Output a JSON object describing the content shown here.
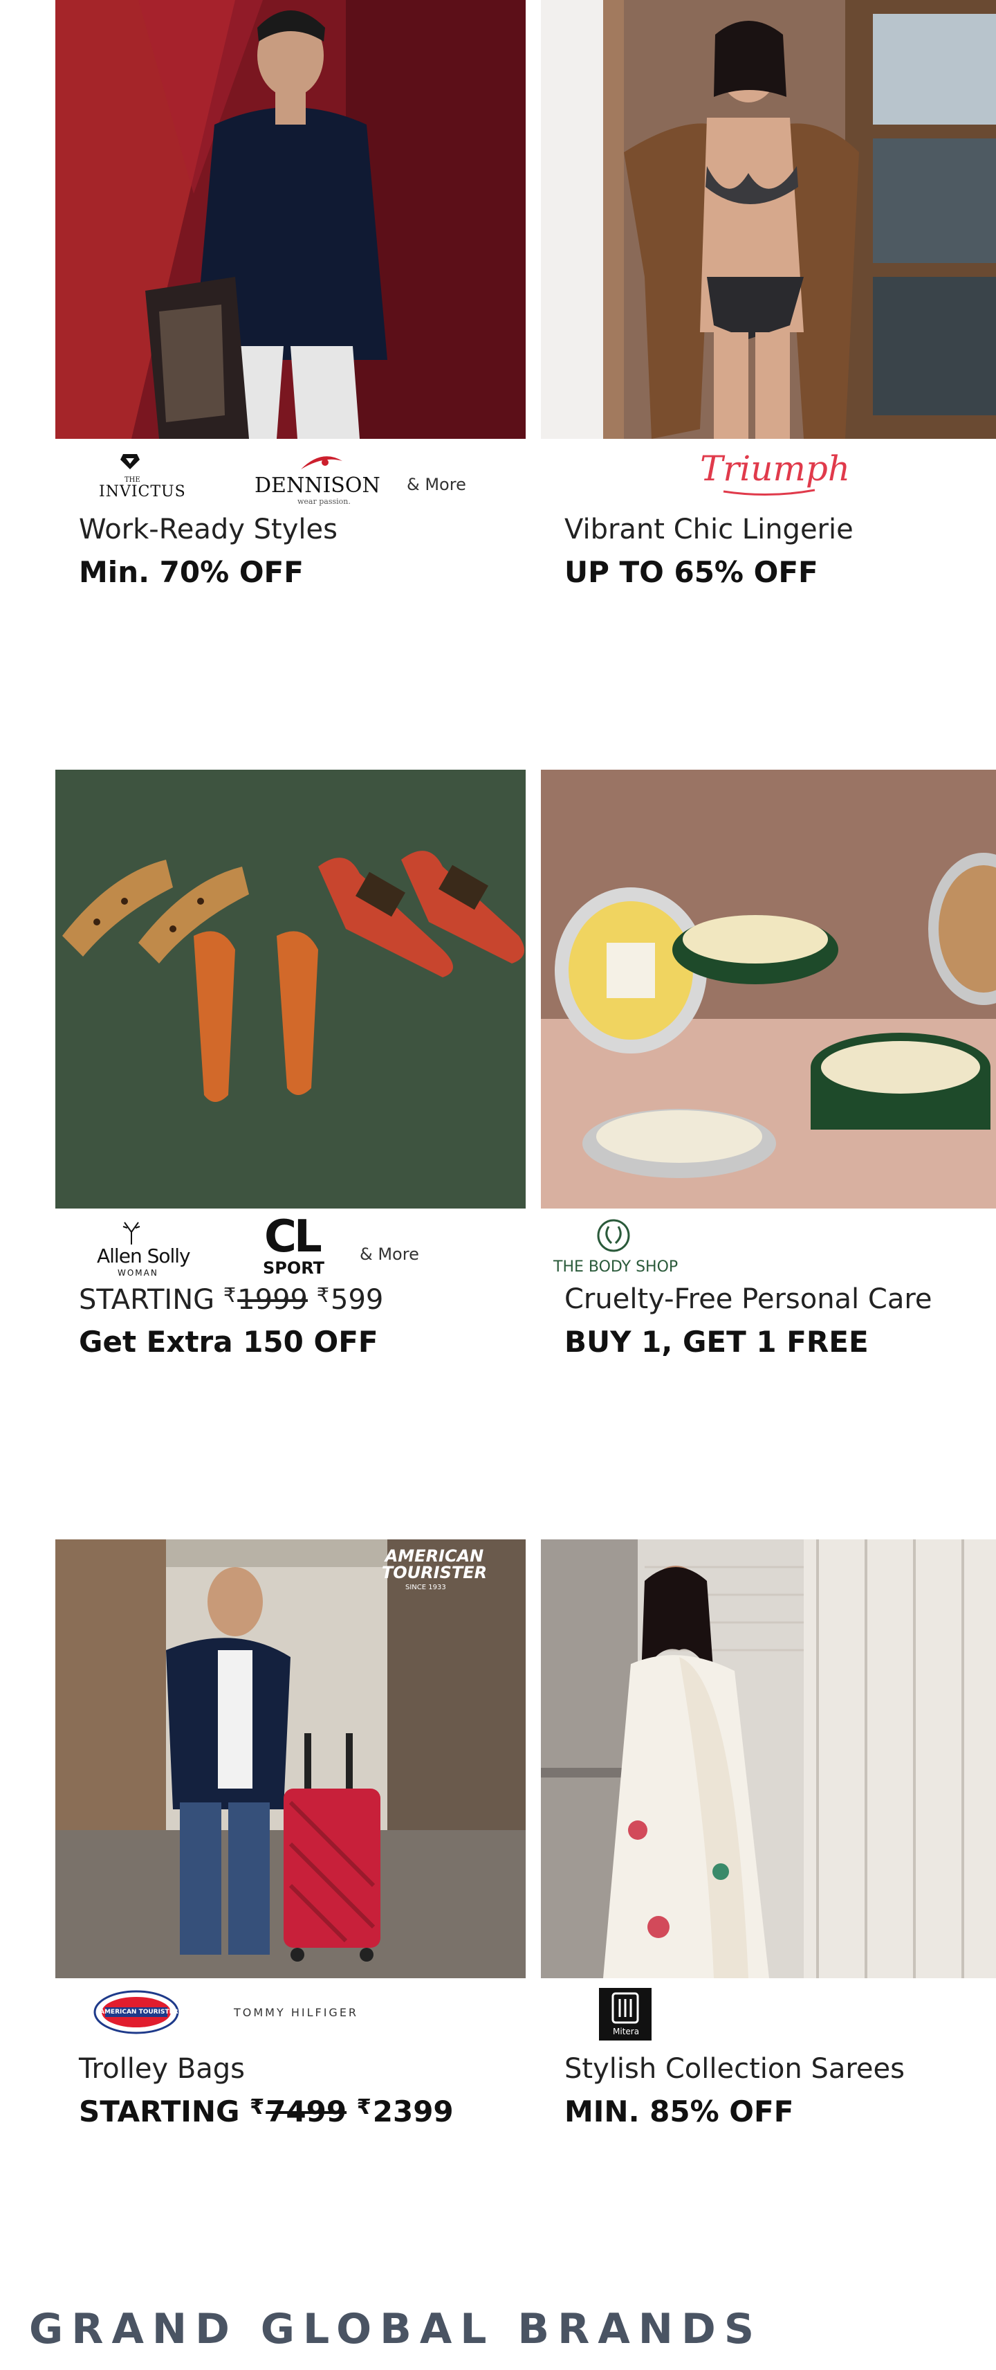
{
  "cards": [
    {
      "title": "Work-Ready Styles",
      "offer": "Min. 70% OFF",
      "logos": [
        "INVICTUS",
        "DENNISON"
      ],
      "invictus_tag": "THE",
      "dennison_tag": "wear passion.",
      "more": "& More"
    },
    {
      "title": "Vibrant Chic Lingerie",
      "offer": "UP TO 65% OFF",
      "logos": [
        "Triumph"
      ]
    },
    {
      "title_prefix": "STARTING",
      "rupee": "₹",
      "old_price": "1999",
      "new_price": "599",
      "offer": "Get Extra 150 OFF",
      "logos": [
        "Allen Solly",
        "CL"
      ],
      "allen_tag": "WOMAN",
      "cl_tag": "SPORT",
      "more": "& More"
    },
    {
      "title": "Cruelty-Free Personal Care",
      "offer": "BUY 1, GET 1 FREE",
      "logos": [
        "THE BODY SHOP"
      ]
    },
    {
      "title": "Trolley Bags",
      "offer_prefix": "STARTING",
      "rupee": "₹",
      "old_price": "7499",
      "new_price": "2399",
      "logos": [
        "AMERICAN TOURISTER",
        "TOMMY HILFIGER"
      ],
      "photo_brand": "AMERICAN TOURISTER",
      "photo_brand_tag": "SINCE 1933"
    },
    {
      "title": "Stylish Collection Sarees",
      "offer": "MIN. 85% OFF",
      "logos": [
        "Mitera"
      ]
    }
  ],
  "section": {
    "title": "GRAND GLOBAL BRANDS"
  },
  "colors": {
    "triumph_red": "#e03a4b",
    "section_title": "#4a5463",
    "dennison_red": "#cc1f2d"
  }
}
